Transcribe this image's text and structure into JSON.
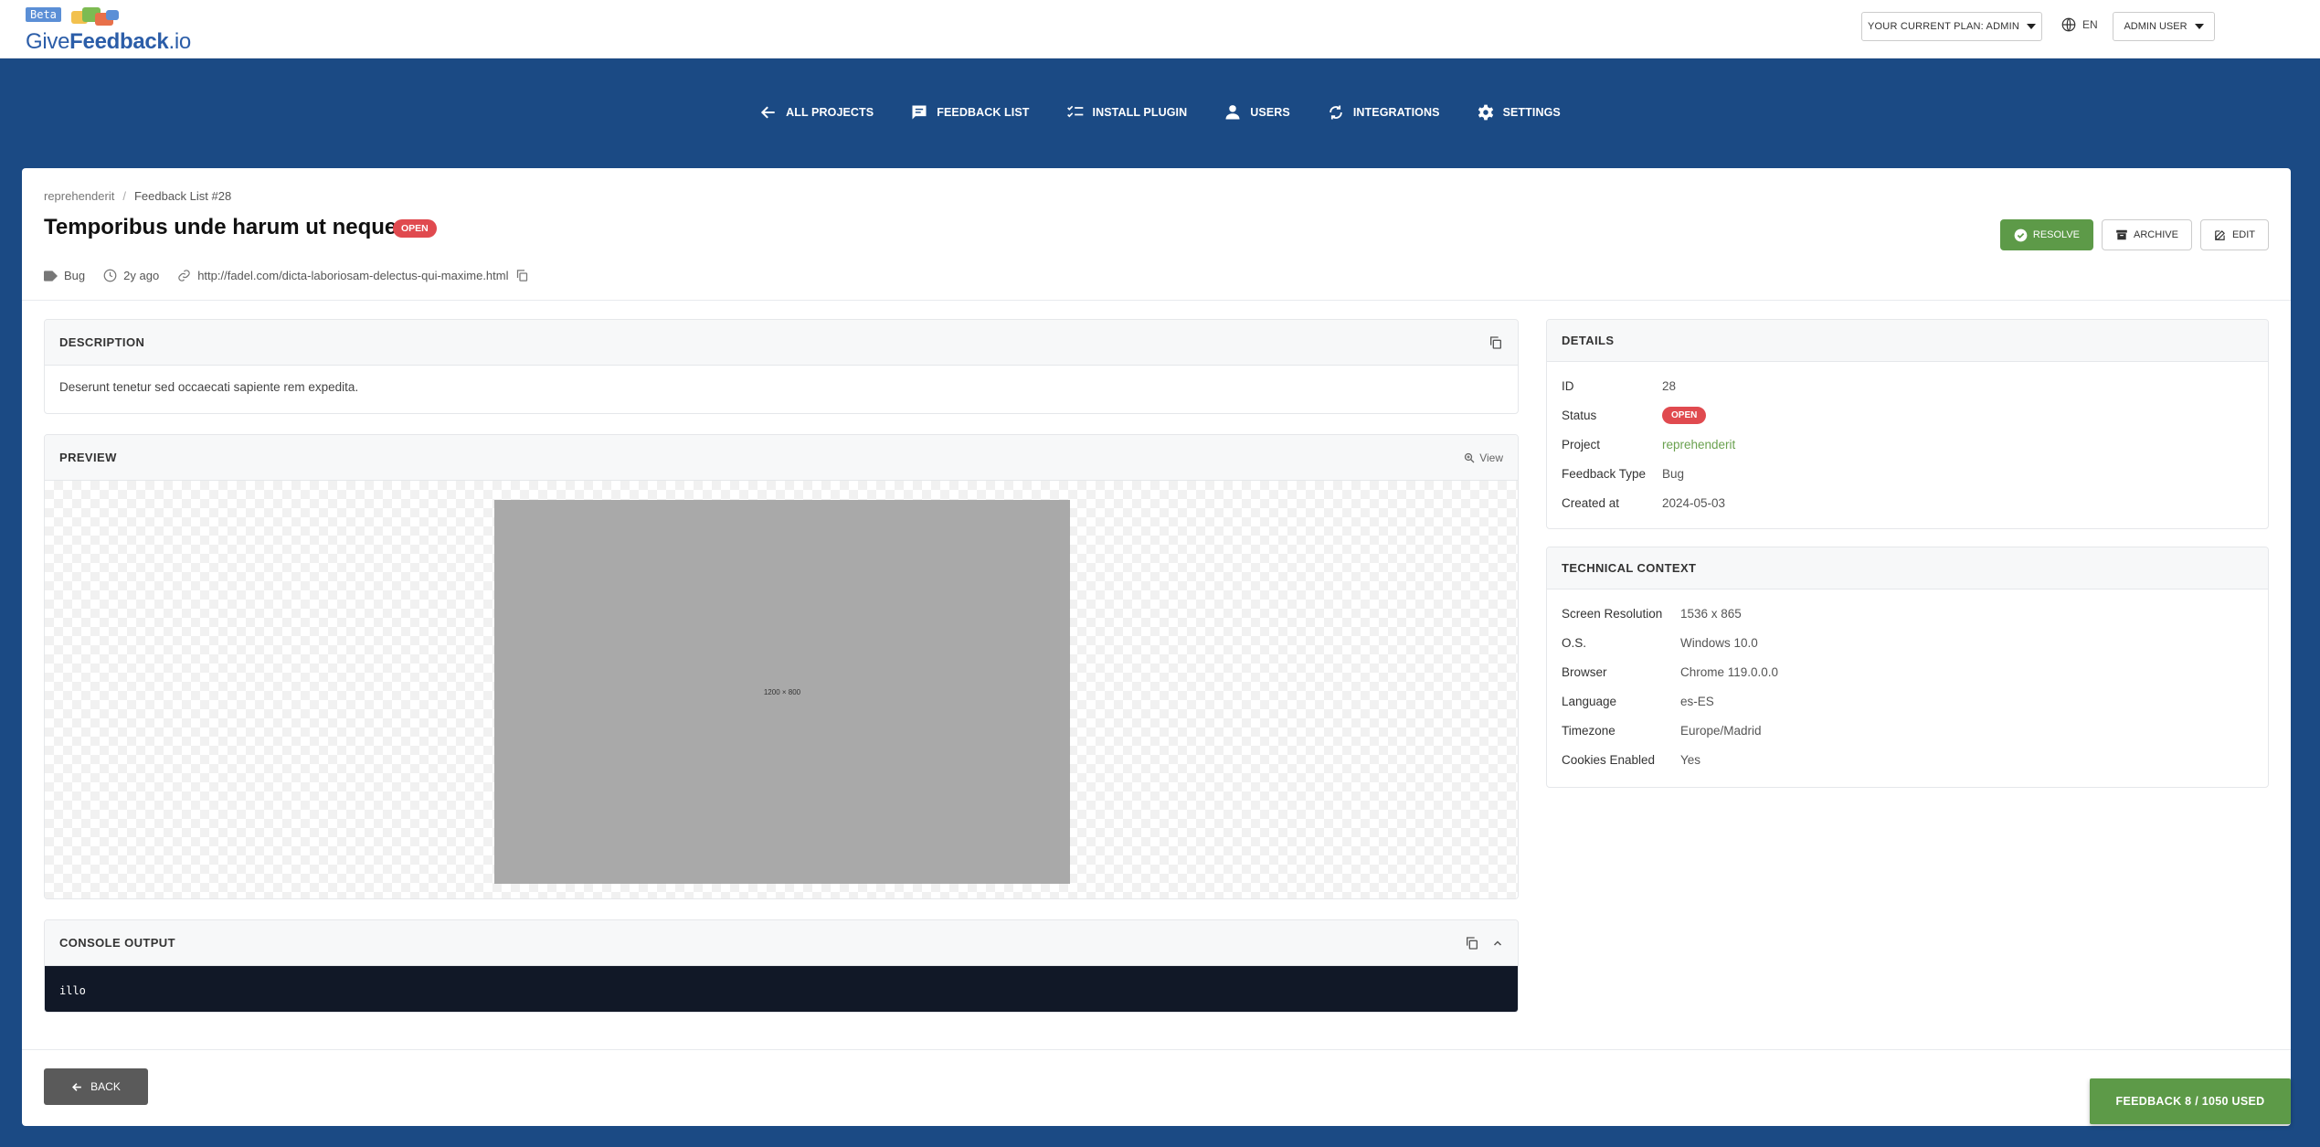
{
  "header": {
    "logo_beta": "Beta",
    "logo_give": "Give",
    "logo_feedback": "Feedback",
    "logo_domain": ".io",
    "plan_label": "YOUR CURRENT PLAN: ADMIN",
    "language": "EN",
    "user_label": "ADMIN USER"
  },
  "nav": {
    "all_projects": "ALL PROJECTS",
    "feedback_list": "FEEDBACK LIST",
    "install_plugin": "INSTALL PLUGIN",
    "users": "USERS",
    "integrations": "INTEGRATIONS",
    "settings": "SETTINGS"
  },
  "breadcrumb": {
    "project": "reprehenderit",
    "separator": "/",
    "current": "Feedback List #28"
  },
  "feedback": {
    "title": "Temporibus unde harum ut neque.",
    "status": "OPEN",
    "type": "Bug",
    "age": "2y ago",
    "url": "http://fadel.com/dicta-laboriosam-delectus-qui-maxime.html"
  },
  "actions": {
    "resolve": "RESOLVE",
    "archive": "ARCHIVE",
    "edit": "EDIT"
  },
  "description": {
    "heading": "DESCRIPTION",
    "text": "Deserunt tenetur sed occaecati sapiente rem expedita."
  },
  "preview": {
    "heading": "PREVIEW",
    "view_label": "View",
    "image_text": "1200 × 800"
  },
  "console": {
    "heading": "CONSOLE OUTPUT",
    "output": "illo"
  },
  "details": {
    "heading": "DETAILS",
    "id_label": "ID",
    "id_value": "28",
    "status_label": "Status",
    "status_value": "OPEN",
    "project_label": "Project",
    "project_value": "reprehenderit",
    "type_label": "Feedback Type",
    "type_value": "Bug",
    "created_label": "Created at",
    "created_value": "2024-05-03"
  },
  "technical": {
    "heading": "TECHNICAL CONTEXT",
    "resolution_label": "Screen Resolution",
    "resolution_value": "1536 x 865",
    "os_label": "O.S.",
    "os_value": "Windows 10.0",
    "browser_label": "Browser",
    "browser_value": "Chrome 119.0.0.0",
    "language_label": "Language",
    "language_value": "es-ES",
    "timezone_label": "Timezone",
    "timezone_value": "Europe/Madrid",
    "cookies_label": "Cookies Enabled",
    "cookies_value": "Yes"
  },
  "footer": {
    "back": "BACK",
    "usage": "FEEDBACK 8 / 1050 USED"
  },
  "colors": {
    "header_bg": "#1b4a84",
    "success": "#5d9a48",
    "danger": "#e04a4f",
    "console_bg": "#111827"
  }
}
